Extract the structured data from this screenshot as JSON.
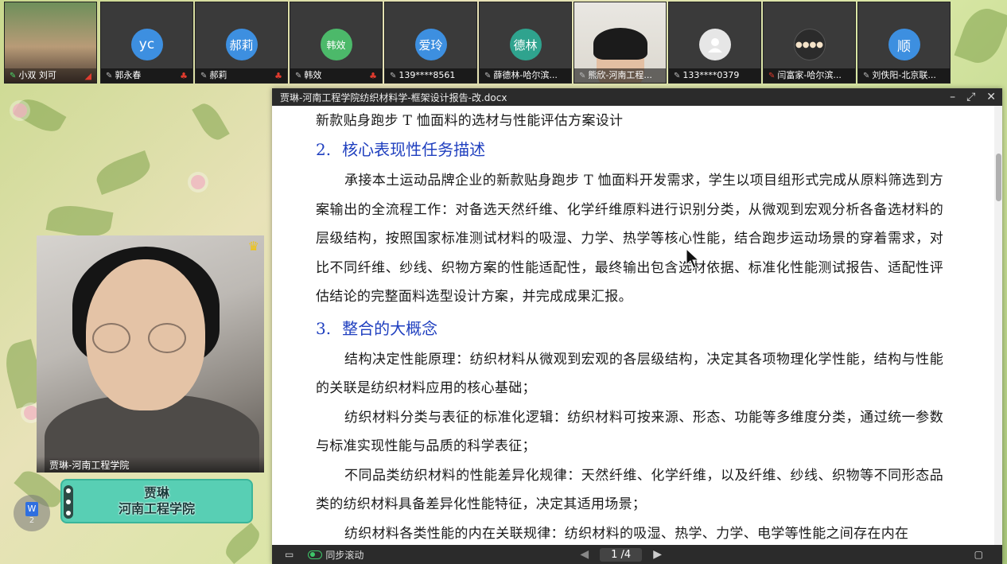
{
  "participants": [
    {
      "name": "小双",
      "name2": "刘可",
      "type": "photo"
    },
    {
      "name": "郭永春",
      "avatar_text": "yc",
      "avatar_color": "#3d8fe0",
      "muted": true
    },
    {
      "name": "郝莉",
      "avatar_text": "郝莉",
      "avatar_color": "#3d8fe0",
      "muted": true
    },
    {
      "name": "韩效",
      "avatar_text": "韩效",
      "avatar_color": "#4cb96a",
      "muted": true
    },
    {
      "name": "139****8561",
      "avatar_text": "爱玲",
      "avatar_color": "#3d8fe0"
    },
    {
      "name": "薛德林-哈尔滨...",
      "avatar_text": "德林",
      "avatar_color": "#2fa38e"
    },
    {
      "name": "熊欣-河南工程...",
      "type": "photo2"
    },
    {
      "name": "133****0379",
      "avatar_text": "",
      "avatar_color": "#e6e6e6"
    },
    {
      "name": "闫富家-哈尔滨...",
      "avatar_text": "",
      "avatar_color": "#2b2b2b"
    },
    {
      "name": "刘佚阳-北京联...",
      "avatar_text": "顺",
      "avatar_color": "#3d8fe0"
    }
  ],
  "document": {
    "window_title": "贾琳-河南工程学院纺织材料学-框架设计报告-改.docx",
    "lines": [
      {
        "kind": "text",
        "text": "新款贴身跑步 T 恤面料的选材与性能评估方案设计"
      },
      {
        "kind": "heading",
        "num": "2.",
        "text": "核心表现性任务描述"
      },
      {
        "kind": "para",
        "text": "承接本土运动品牌企业的新款贴身跑步 T 恤面料开发需求，学生以项目组形式完成从原料筛选到方案输出的全流程工作：对备选天然纤维、化学纤维原料进行识别分类，从微观到宏观分析各备选材料的层级结构，按照国家标准测试材料的吸湿、力学、热学等核心性能，结合跑步运动场景的穿着需求，对比不同纤维、纱线、织物方案的性能适配性，最终输出包含选材依据、标准化性能测试报告、适配性评估结论的完整面料选型设计方案，并完成成果汇报。"
      },
      {
        "kind": "heading",
        "num": "3.",
        "text": "整合的大概念"
      },
      {
        "kind": "para",
        "text": "结构决定性能原理：纺织材料从微观到宏观的各层级结构，决定其各项物理化学性能，结构与性能的关联是纺织材料应用的核心基础；"
      },
      {
        "kind": "para",
        "text": "纺织材料分类与表征的标准化逻辑：纺织材料可按来源、形态、功能等多维度分类，通过统一参数与标准实现性能与品质的科学表征；"
      },
      {
        "kind": "para",
        "text": "不同品类纺织材料的性能差异化规律：天然纤维、化学纤维，以及纤维、纱线、织物等不同形态品类的纺织材料具备差异化性能特征，决定其适用场景；"
      },
      {
        "kind": "para",
        "text": "纺织材料各类性能的内在关联规律：纺织材料的吸湿、热学、力学、电学等性能之间存在内在"
      }
    ],
    "footer": {
      "sync_scroll_label": "同步滚动",
      "page_indicator": "1 /4"
    }
  },
  "speaker": {
    "label": "贾琳-河南工程学院",
    "card_name": "贾琳",
    "card_org": "河南工程学院"
  },
  "float_button": {
    "count": "2"
  }
}
